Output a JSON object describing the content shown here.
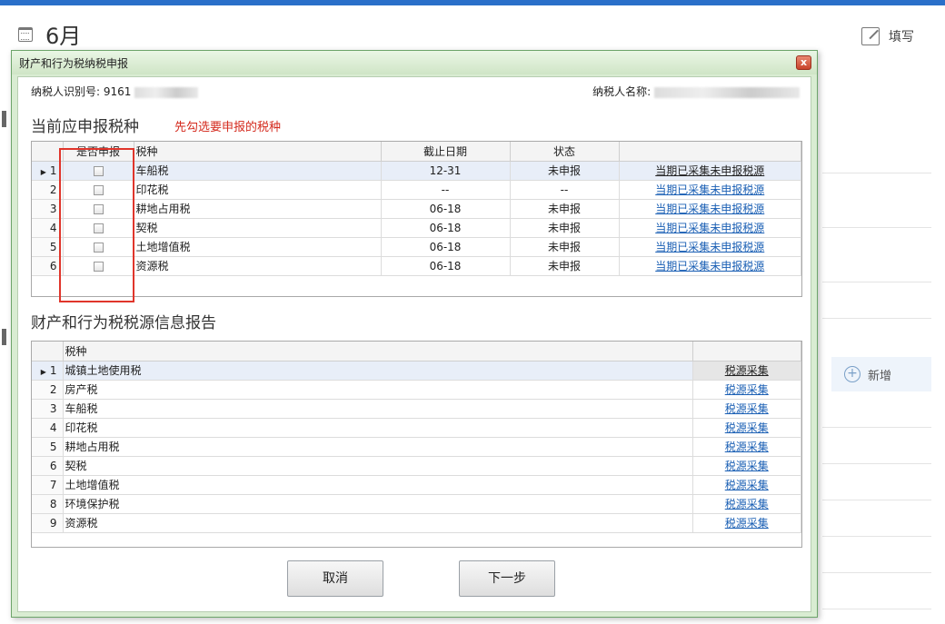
{
  "page": {
    "month": "6月",
    "write_label": "填写",
    "add_label": "新增"
  },
  "dialog": {
    "title": "财产和行为税纳税申报",
    "close": "x",
    "taxpayer_id_label": "纳税人识别号:",
    "taxpayer_id_value": "9161",
    "taxpayer_name_label": "纳税人名称:",
    "taxpayer_name_value": "",
    "section1_title": "当前应申报税种",
    "hint": "先勾选要申报的税种",
    "section2_title": "财产和行为税税源信息报告",
    "cancel_label": "取消",
    "next_label": "下一步"
  },
  "grid1": {
    "headers": [
      "是否申报",
      "税种",
      "截止日期",
      "状态",
      ""
    ],
    "rows": [
      {
        "num": "1",
        "tax": "车船税",
        "deadline": "12-31",
        "status": "未申报",
        "link": "当期已采集未申报税源"
      },
      {
        "num": "2",
        "tax": "印花税",
        "deadline": "--",
        "status": "--",
        "link": "当期已采集未申报税源"
      },
      {
        "num": "3",
        "tax": "耕地占用税",
        "deadline": "06-18",
        "status": "未申报",
        "link": "当期已采集未申报税源"
      },
      {
        "num": "4",
        "tax": "契税",
        "deadline": "06-18",
        "status": "未申报",
        "link": "当期已采集未申报税源"
      },
      {
        "num": "5",
        "tax": "土地增值税",
        "deadline": "06-18",
        "status": "未申报",
        "link": "当期已采集未申报税源"
      },
      {
        "num": "6",
        "tax": "资源税",
        "deadline": "06-18",
        "status": "未申报",
        "link": "当期已采集未申报税源"
      }
    ]
  },
  "grid2": {
    "headers": [
      "税种",
      ""
    ],
    "rows": [
      {
        "num": "1",
        "tax": "城镇土地使用税",
        "link": "税源采集"
      },
      {
        "num": "2",
        "tax": "房产税",
        "link": "税源采集"
      },
      {
        "num": "3",
        "tax": "车船税",
        "link": "税源采集"
      },
      {
        "num": "4",
        "tax": "印花税",
        "link": "税源采集"
      },
      {
        "num": "5",
        "tax": "耕地占用税",
        "link": "税源采集"
      },
      {
        "num": "6",
        "tax": "契税",
        "link": "税源采集"
      },
      {
        "num": "7",
        "tax": "土地增值税",
        "link": "税源采集"
      },
      {
        "num": "8",
        "tax": "环境保护税",
        "link": "税源采集"
      },
      {
        "num": "9",
        "tax": "资源税",
        "link": "税源采集"
      }
    ]
  }
}
